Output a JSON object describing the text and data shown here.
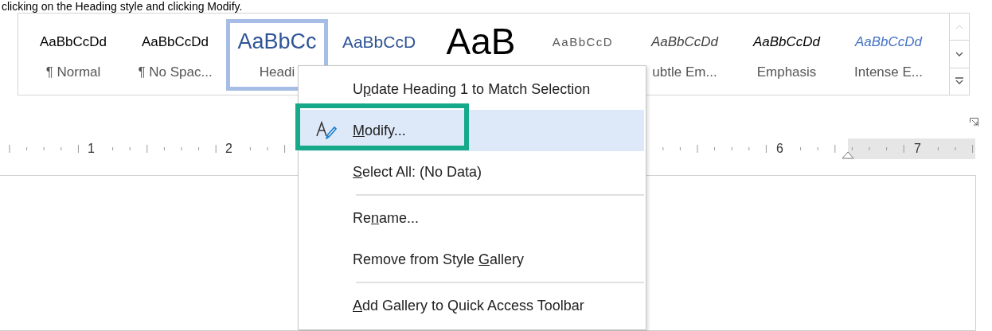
{
  "caption": "clicking on the Heading style and clicking Modify.",
  "style_gallery": {
    "items": [
      {
        "preview": "AaBbCcDd",
        "label": "¶ Normal",
        "kind": "normal",
        "selected": false
      },
      {
        "preview": "AaBbCcDd",
        "label": "¶ No Spac...",
        "kind": "normal",
        "selected": false
      },
      {
        "preview": "AaBbCc",
        "label": "Headi",
        "kind": "heading1",
        "selected": true
      },
      {
        "preview": "AaBbCcD",
        "kind": "heading2",
        "selected": false
      },
      {
        "preview": "AaB",
        "kind": "title",
        "selected": false
      },
      {
        "preview": "AaBbCcD",
        "kind": "subtitle",
        "selected": false
      },
      {
        "preview": "AaBbCcDd",
        "label": "ubtle Em...",
        "kind": "subtle",
        "selected": false
      },
      {
        "preview": "AaBbCcDd",
        "label": "Emphasis",
        "kind": "emphasis",
        "selected": false
      },
      {
        "preview": "AaBbCcDd",
        "label": "Intense E...",
        "kind": "intense",
        "selected": false
      }
    ]
  },
  "ruler": {
    "numbers": [
      "1",
      "2",
      "6",
      "7"
    ]
  },
  "context_menu": {
    "items": [
      {
        "kind": "item",
        "label": {
          "before": "U",
          "key": "p",
          "after": "date Heading 1 to Match Selection"
        },
        "selected": false
      },
      {
        "kind": "item",
        "label": {
          "key": "M",
          "after": "odify..."
        },
        "selected": true,
        "icon": true,
        "highlighted": true
      },
      {
        "kind": "item",
        "label": {
          "key": "S",
          "after": "elect All: (No Data)"
        },
        "selected": false
      },
      {
        "kind": "separator"
      },
      {
        "kind": "item",
        "label": {
          "before": "Re",
          "key": "n",
          "after": "ame..."
        },
        "selected": false
      },
      {
        "kind": "item",
        "label": {
          "before": "Remove from Style ",
          "key": "G",
          "after": "allery"
        },
        "selected": false
      },
      {
        "kind": "separator"
      },
      {
        "kind": "item",
        "label": {
          "key": "A",
          "after": "dd Gallery to Quick Access Toolbar"
        },
        "selected": false
      }
    ]
  }
}
